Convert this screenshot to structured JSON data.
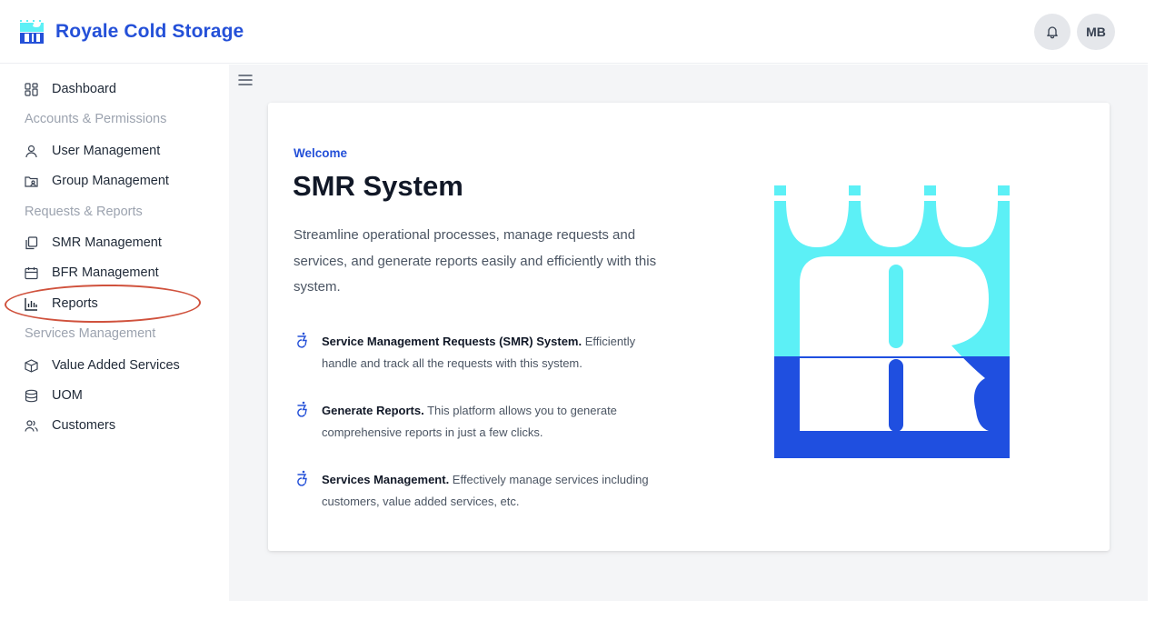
{
  "app": {
    "brand_name": "Royale Cold Storage",
    "user_initials": "MB",
    "brand_color": "#2450d8",
    "logo_colors": {
      "cyan": "#5cf0f6",
      "blue": "#1f4fe0"
    }
  },
  "sidebar": {
    "dashboard": "Dashboard",
    "section_accounts": "Accounts & Permissions",
    "user_management": "User Management",
    "group_management": "Group Management",
    "section_requests": "Requests & Reports",
    "smr_management": "SMR Management",
    "bfr_management": "BFR Management",
    "reports": "Reports",
    "section_services": "Services Management",
    "value_added_services": "Value Added Services",
    "uom": "UOM",
    "customers": "Customers",
    "highlight_color": "#d0523d"
  },
  "main": {
    "welcome": "Welcome",
    "title": "SMR System",
    "description": "Streamline operational processes, manage requests and services, and generate reports easily and efficiently with this system.",
    "features": [
      {
        "title": "Service Management Requests (SMR) System.",
        "text": " Efficiently handle and track all the requests with this system."
      },
      {
        "title": "Generate Reports.",
        "text": " This platform allows you to generate comprehensive reports in just a few clicks."
      },
      {
        "title": "Services Management.",
        "text": " Effectively manage services including customers, value added services, etc."
      }
    ]
  }
}
